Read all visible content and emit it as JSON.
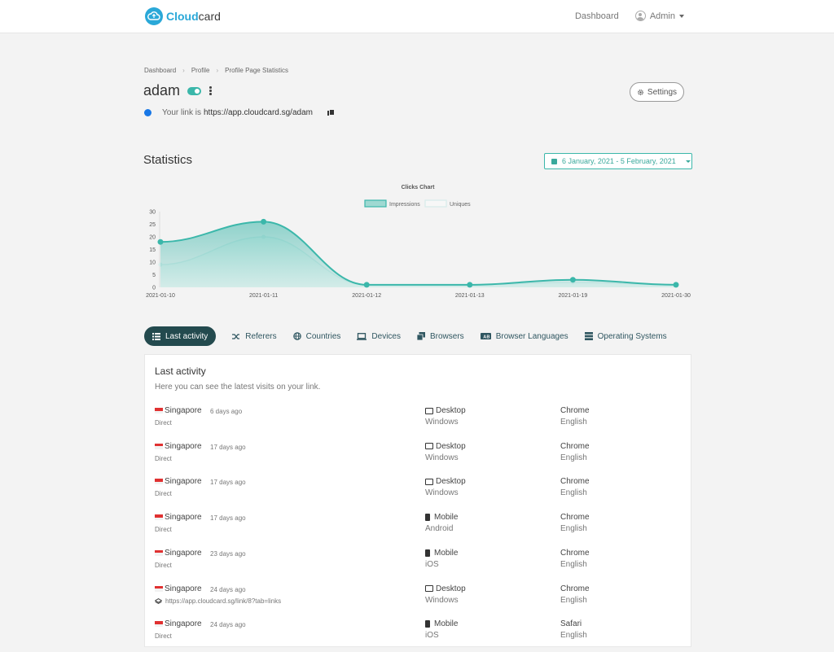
{
  "header": {
    "logo_bold": "Cloud",
    "logo_rest": "card",
    "nav_dashboard": "Dashboard",
    "nav_user": "Admin"
  },
  "breadcrumb": [
    "Dashboard",
    "Profile",
    "Profile Page Statistics"
  ],
  "profile": {
    "name": "adam",
    "settings_label": "Settings",
    "link_prefix": "Your link is",
    "link_url": "https://app.cloudcard.sg/adam"
  },
  "statistics": {
    "title": "Statistics",
    "date_range": "6 January, 2021 - 5 February, 2021"
  },
  "chart_data": {
    "type": "area",
    "title": "Clicks Chart",
    "x": [
      "2021-01-10",
      "2021-01-11",
      "2021-01-12",
      "2021-01-13",
      "2021-01-19",
      "2021-01-30"
    ],
    "series": [
      {
        "name": "Impressions",
        "values": [
          18,
          26,
          1,
          1,
          3,
          1
        ],
        "color": "#3bb7aa"
      },
      {
        "name": "Uniques",
        "values": [
          9,
          20,
          1,
          1,
          2,
          1
        ],
        "color": "#d6ecea"
      }
    ],
    "ylim": [
      0,
      30
    ],
    "yticks": [
      0,
      5,
      10,
      15,
      20,
      25,
      30
    ],
    "legend": "top",
    "grid": false
  },
  "tabs": [
    {
      "label": "Last activity",
      "icon": "list-icon",
      "active": true
    },
    {
      "label": "Referers",
      "icon": "shuffle-icon",
      "active": false
    },
    {
      "label": "Countries",
      "icon": "globe-icon",
      "active": false
    },
    {
      "label": "Devices",
      "icon": "laptop-icon",
      "active": false
    },
    {
      "label": "Browsers",
      "icon": "browsers-icon",
      "active": false
    },
    {
      "label": "Browser Languages",
      "icon": "language-icon",
      "active": false
    },
    {
      "label": "Operating Systems",
      "icon": "server-icon",
      "active": false
    }
  ],
  "activity": {
    "title": "Last activity",
    "subtitle": "Here you can see the latest visits on your link.",
    "rows": [
      {
        "country": "Singapore",
        "ago": "6 days ago",
        "source": "Direct",
        "device": "Desktop",
        "os": "Windows",
        "browser": "Chrome",
        "language": "English"
      },
      {
        "country": "Singapore",
        "ago": "17 days ago",
        "source": "Direct",
        "device": "Desktop",
        "os": "Windows",
        "browser": "Chrome",
        "language": "English"
      },
      {
        "country": "Singapore",
        "ago": "17 days ago",
        "source": "Direct",
        "device": "Desktop",
        "os": "Windows",
        "browser": "Chrome",
        "language": "English"
      },
      {
        "country": "Singapore",
        "ago": "17 days ago",
        "source": "Direct",
        "device": "Mobile",
        "os": "Android",
        "browser": "Chrome",
        "language": "English"
      },
      {
        "country": "Singapore",
        "ago": "23 days ago",
        "source": "Direct",
        "device": "Mobile",
        "os": "iOS",
        "browser": "Chrome",
        "language": "English"
      },
      {
        "country": "Singapore",
        "ago": "24 days ago",
        "source": "https://app.cloudcard.sg/link/8?tab=links",
        "device": "Desktop",
        "os": "Windows",
        "browser": "Chrome",
        "language": "English"
      },
      {
        "country": "Singapore",
        "ago": "24 days ago",
        "source": "Direct",
        "device": "Mobile",
        "os": "iOS",
        "browser": "Safari",
        "language": "English"
      }
    ]
  },
  "colors": {
    "accent": "#3bb7aa",
    "brand": "#2aa8d8",
    "tab_active": "#234a4e",
    "link_dot": "#1877e6"
  }
}
